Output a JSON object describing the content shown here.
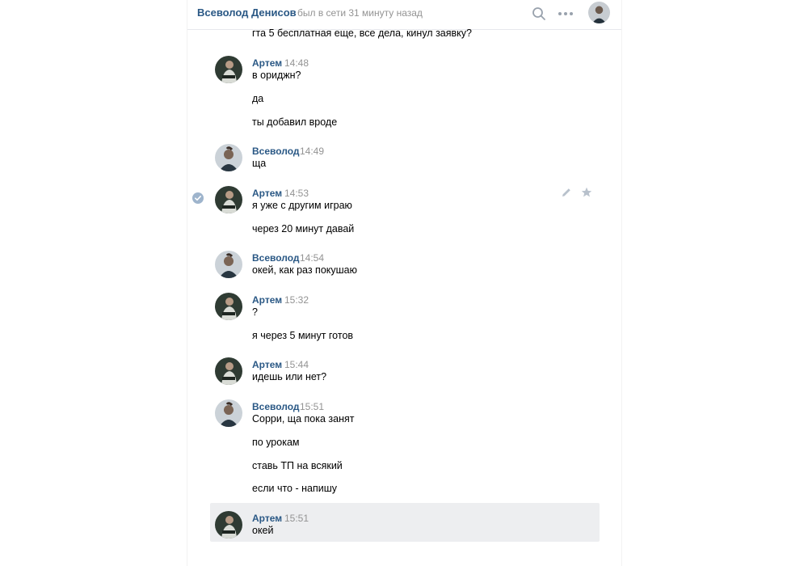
{
  "header": {
    "name": "Всеволод Денисов",
    "status": "был в сети 31 минуту назад",
    "icons": [
      "search-icon",
      "more-icon",
      "avatar"
    ]
  },
  "colors": {
    "accent": "#2a5885",
    "muted": "#939393",
    "selected": "#edeef0",
    "check": "#9eb4cc"
  },
  "messages": [
    {
      "text": "гта 5 бесплатная еще, все дела, кинул заявку?"
    },
    {
      "author": "Артем",
      "time": "14:48",
      "lines": [
        "в ориджн?",
        "да",
        "ты добавил вроде"
      ]
    },
    {
      "author": "Всеволод",
      "time": "14:49",
      "lines": [
        "ща"
      ]
    },
    {
      "author": "Артем",
      "time": "14:53",
      "lines": [
        "я уже с другим играю",
        "через 20 минут давай"
      ]
    },
    {
      "author": "Всеволод",
      "time": "14:54",
      "lines": [
        "окей, как раз покушаю"
      ]
    },
    {
      "author": "Артем",
      "time": "15:32",
      "lines": [
        "?",
        "я через 5 минут готов"
      ]
    },
    {
      "author": "Артем",
      "time": "15:44",
      "lines": [
        "идешь или нет?"
      ]
    },
    {
      "author": "Всеволод",
      "time": "15:51",
      "lines": [
        "Сорри, ща пока занят",
        "по урокам",
        "ставь ТП на всякий",
        "если что - напишу"
      ]
    },
    {
      "author": "Артем",
      "time": "15:51",
      "lines": [
        "окей"
      ]
    }
  ]
}
